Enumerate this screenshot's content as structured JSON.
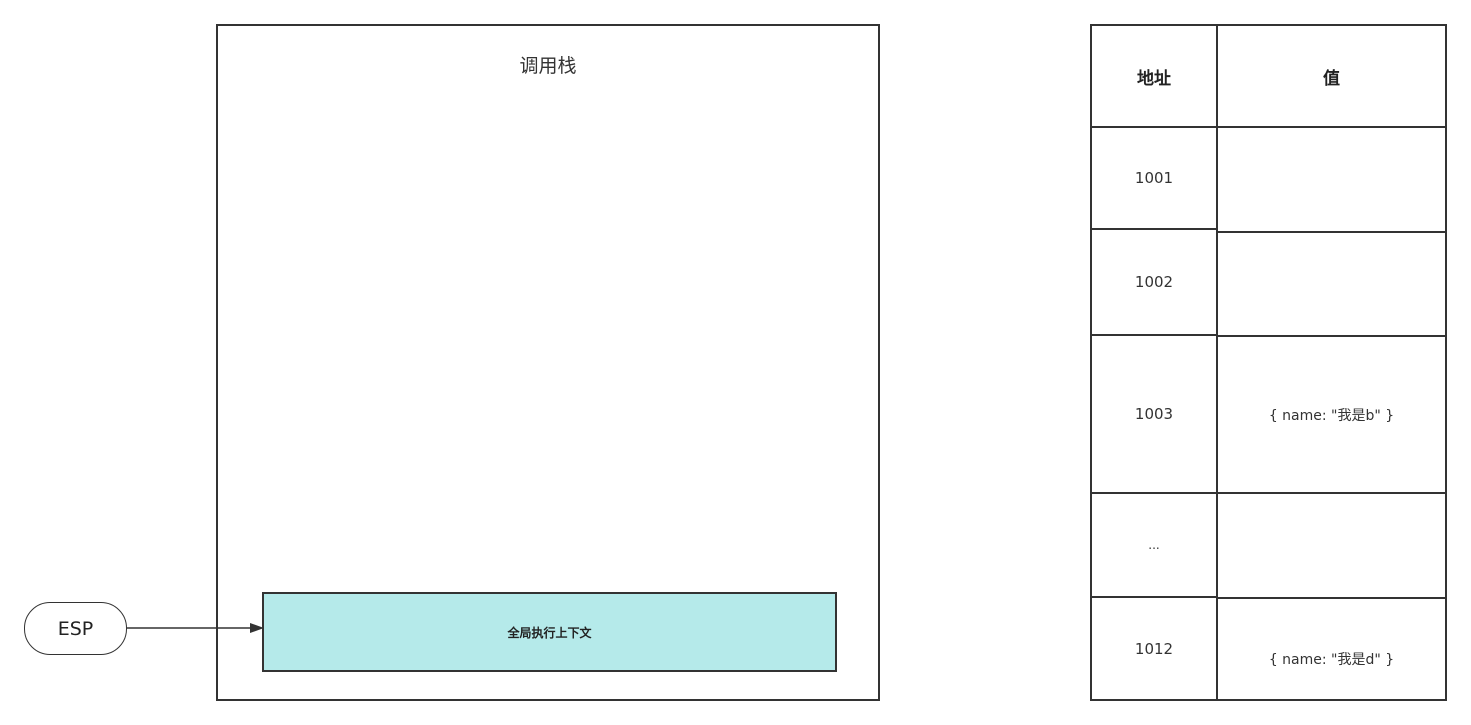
{
  "call_stack": {
    "title": "调用栈",
    "frames": [
      {
        "label": "全局执行上下文"
      }
    ]
  },
  "stack_pointer": {
    "label": "ESP"
  },
  "memory_table": {
    "headers": {
      "address": "地址",
      "value": "值"
    },
    "rows": [
      {
        "address": "1001",
        "value": ""
      },
      {
        "address": "1002",
        "value": ""
      },
      {
        "address": "1003",
        "value": "{ name: \"我是b\" }"
      },
      {
        "address": "...",
        "value": ""
      },
      {
        "address": "1012",
        "value": "{ name: \"我是d\" }"
      }
    ]
  },
  "colors": {
    "stroke": "#333333",
    "frame_fill": "#b5eaea"
  }
}
